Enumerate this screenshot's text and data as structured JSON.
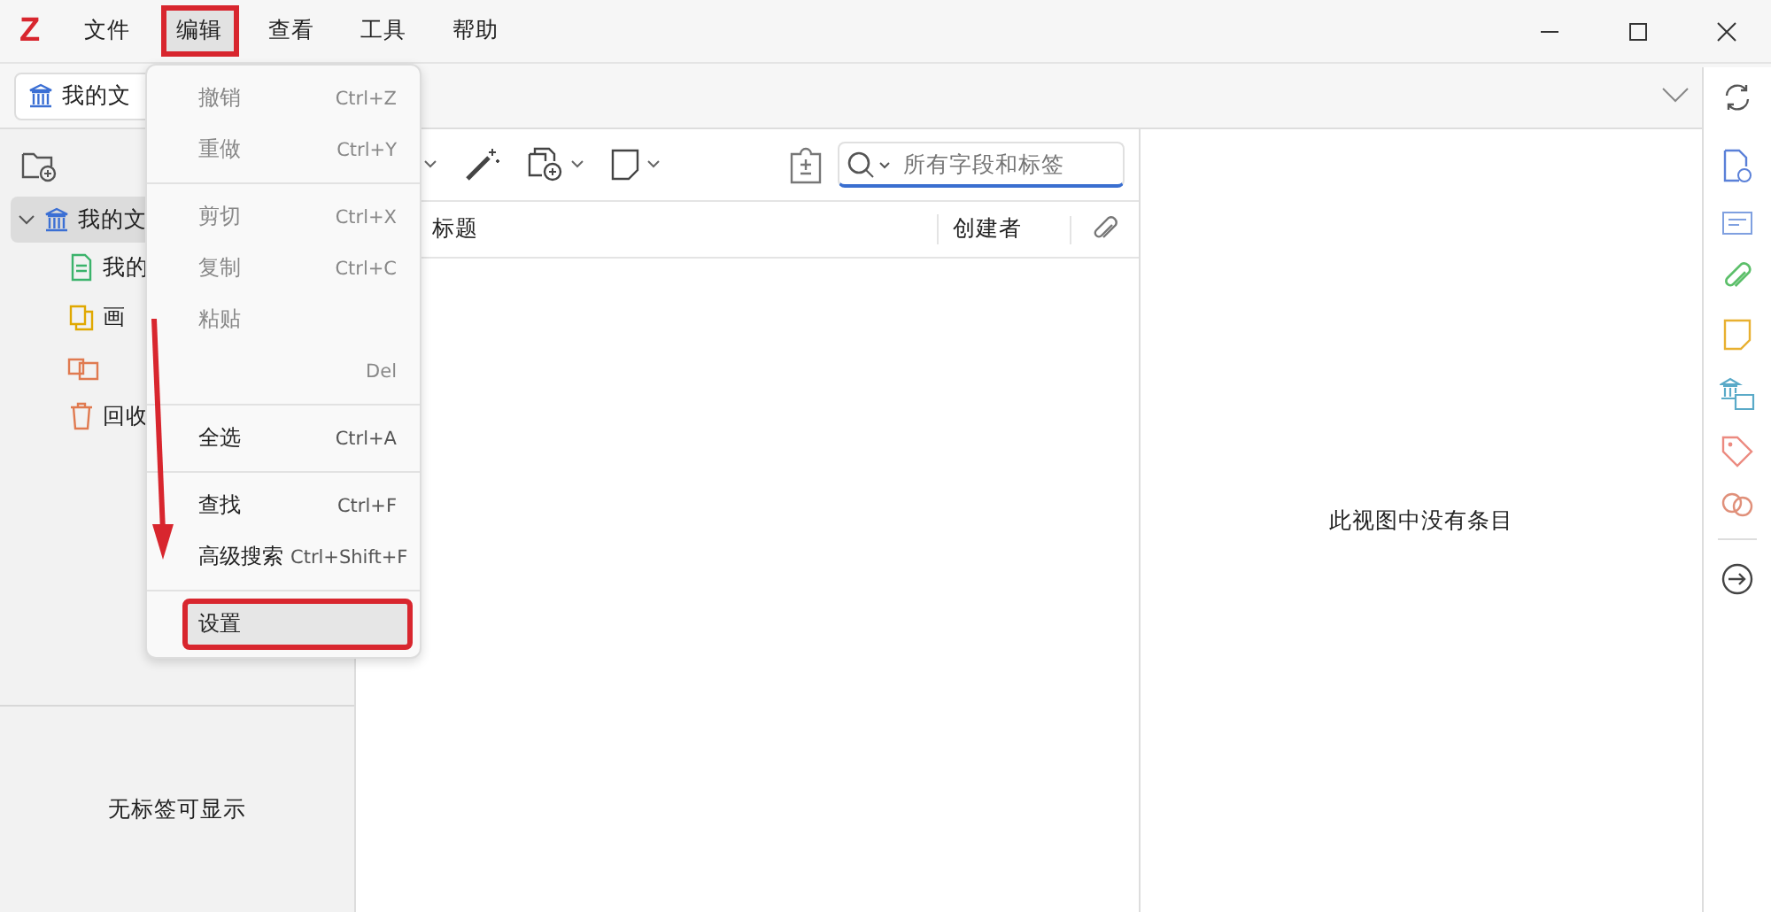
{
  "logo": "Z",
  "app_menu": [
    {
      "label": "文件",
      "selected": false,
      "annotated": false
    },
    {
      "label": "编辑",
      "selected": true,
      "annotated": true
    },
    {
      "label": "查看",
      "selected": false,
      "annotated": false
    },
    {
      "label": "工具",
      "selected": false,
      "annotated": false
    },
    {
      "label": "帮助",
      "selected": false,
      "annotated": false
    }
  ],
  "library_tab": {
    "label": "我的文"
  },
  "tree": [
    {
      "label": "我的文",
      "selected": true,
      "expanded": true,
      "children": [
        {
          "label": "我的",
          "kind": "collection"
        },
        {
          "label": "画",
          "kind": "gallery"
        },
        {
          "kind": "feed"
        },
        {
          "label": "回收",
          "kind": "trash"
        }
      ]
    }
  ],
  "tags_pane": {
    "message": "无标签可显示"
  },
  "search": {
    "placeholder": "所有字段和标签"
  },
  "columns": [
    {
      "label": "标题"
    },
    {
      "label": "创建者"
    }
  ],
  "empty_message": "此视图中没有条目",
  "edit_menu": [
    [
      {
        "label": "撤销",
        "shortcut": "Ctrl+Z",
        "disabled": true,
        "highlighted": false,
        "annotated": false
      },
      {
        "label": "重做",
        "shortcut": "Ctrl+Y",
        "disabled": true,
        "highlighted": false,
        "annotated": false
      }
    ],
    [
      {
        "label": "剪切",
        "shortcut": "Ctrl+X",
        "disabled": true,
        "highlighted": false,
        "annotated": false
      },
      {
        "label": "复制",
        "shortcut": "Ctrl+C",
        "disabled": true,
        "highlighted": false,
        "annotated": false
      },
      {
        "label": "粘贴",
        "disabled": true,
        "highlighted": false,
        "annotated": false
      },
      {
        "shortcut": "Del",
        "disabled": true,
        "highlighted": false,
        "annotated": false
      }
    ],
    [
      {
        "label": "全选",
        "shortcut": "Ctrl+A",
        "disabled": false,
        "highlighted": false,
        "annotated": false
      }
    ],
    [
      {
        "label": "查找",
        "shortcut": "Ctrl+F",
        "disabled": false,
        "highlighted": false,
        "annotated": false
      },
      {
        "label": "高级搜索",
        "shortcut": "Ctrl+Shift+F",
        "disabled": false,
        "highlighted": false,
        "annotated": false
      }
    ],
    [
      {
        "label": "设置",
        "disabled": false,
        "highlighted": true,
        "annotated": true
      }
    ]
  ]
}
